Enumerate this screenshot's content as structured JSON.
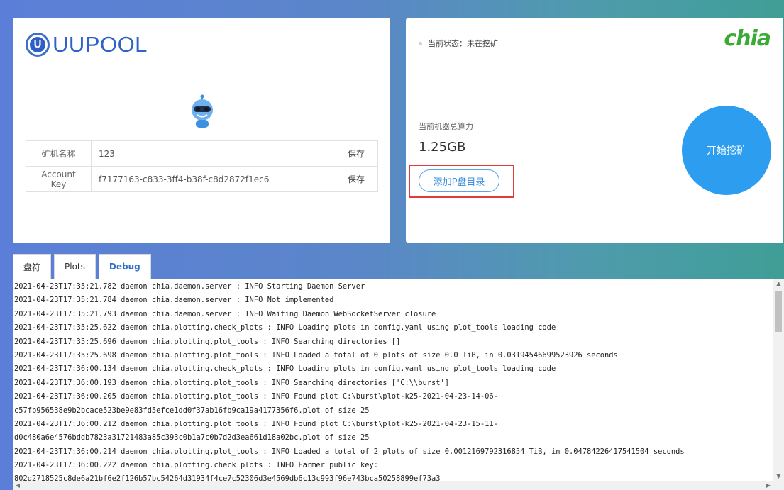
{
  "brand": {
    "name": "UUPOOL",
    "logo_letter": "U"
  },
  "miner_info": {
    "rows": [
      {
        "key": "矿机名称",
        "value": "123",
        "action": "保存"
      },
      {
        "key": "Account Key",
        "value": "f7177163-c833-3ff4-b38f-c8d2872f1ec6",
        "action": "保存"
      }
    ]
  },
  "mining": {
    "status_text": "当前状态：未在挖矿",
    "coin_logo": "chia",
    "hashrate_label": "当前机器总算力",
    "hashrate_value": "1.25GB",
    "add_dir_button": "添加P盘目录",
    "start_button": "开始挖矿",
    "colors": {
      "accent": "#2d9eef",
      "highlight": "#e23b3b",
      "chia_green": "#3aaa35"
    }
  },
  "tabs": [
    {
      "label": "盘符",
      "active": false
    },
    {
      "label": "Plots",
      "active": false
    },
    {
      "label": "Debug",
      "active": true
    }
  ],
  "log": [
    "2021-04-23T17:35:21.782 daemon chia.daemon.server : INFO Starting Daemon Server",
    "2021-04-23T17:35:21.784 daemon chia.daemon.server : INFO Not implemented",
    "2021-04-23T17:35:21.793 daemon chia.daemon.server : INFO Waiting Daemon WebSocketServer closure",
    "2021-04-23T17:35:25.622 daemon chia.plotting.check_plots : INFO Loading plots in config.yaml using plot_tools loading code",
    "2021-04-23T17:35:25.696 daemon chia.plotting.plot_tools : INFO Searching directories []",
    "2021-04-23T17:35:25.698 daemon chia.plotting.plot_tools : INFO Loaded a total of 0 plots of size 0.0 TiB, in 0.03194546699523926 seconds",
    "2021-04-23T17:36:00.134 daemon chia.plotting.check_plots : INFO Loading plots in config.yaml using plot_tools loading code",
    "2021-04-23T17:36:00.193 daemon chia.plotting.plot_tools : INFO Searching directories ['C:\\\\burst']",
    "2021-04-23T17:36:00.205 daemon chia.plotting.plot_tools : INFO Found plot C:\\burst\\plot-k25-2021-04-23-14-06-",
    "c57fb956538e9b2bcace523be9e83fd5efce1dd0f37ab16fb9ca19a4177356f6.plot of size 25",
    "2021-04-23T17:36:00.212 daemon chia.plotting.plot_tools : INFO Found plot C:\\burst\\plot-k25-2021-04-23-15-11-",
    "d0c480a6e4576bddb7823a31721483a85c393c0b1a7c0b7d2d3ea661d18a02bc.plot of size 25",
    "2021-04-23T17:36:00.214 daemon chia.plotting.plot_tools : INFO Loaded a total of 2 plots of size 0.0012169792316854 TiB, in 0.04784226417541504 seconds",
    "2021-04-23T17:36:00.222 daemon chia.plotting.check_plots : INFO Farmer public key:",
    "802d2718525c8de6a21bf6e2f126b57bc54264d31934f4ce7c52306d3e4569db6c13c993f96e743bca50258899ef73a3"
  ]
}
